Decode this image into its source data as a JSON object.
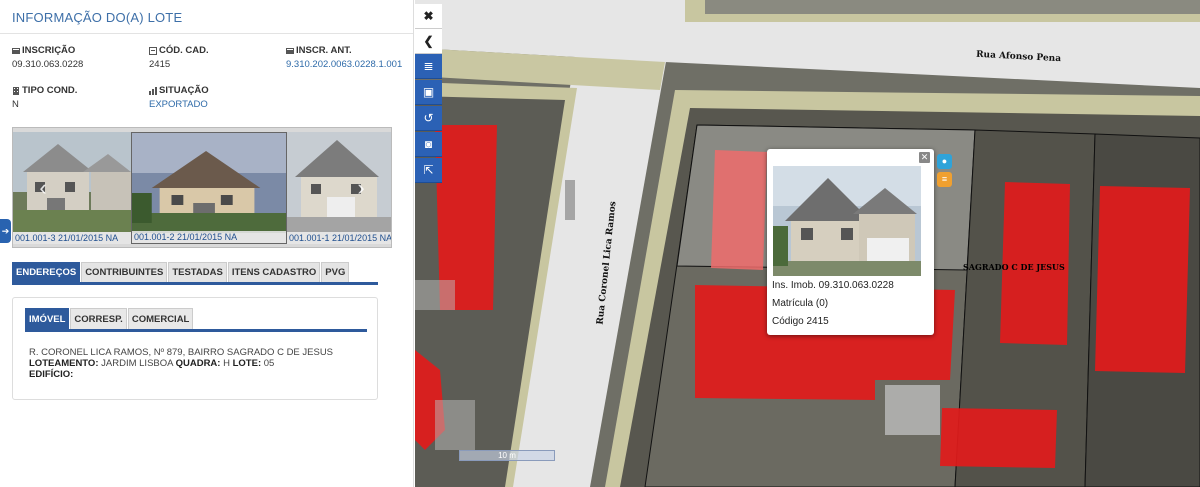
{
  "panel": {
    "title": "INFORMAÇÃO DO(A) LOTE",
    "fields": [
      {
        "label": "INSCRIÇÃO",
        "value": "09.310.063.0228",
        "link": false
      },
      {
        "label": "CÓD. CAD.",
        "value": "2415",
        "link": false
      },
      {
        "label": "INSCR. ANT.",
        "value": "9.310.202.0063.0228.1.001",
        "link": true
      },
      {
        "label": "TIPO COND.",
        "value": "N",
        "link": false
      },
      {
        "label": "SITUAÇÃO",
        "value": "EXPORTADO",
        "link": true
      }
    ],
    "photos": [
      {
        "caption": "001.001-3 21/01/2015 NA"
      },
      {
        "caption": "001.001-2 21/01/2015 NA"
      },
      {
        "caption": "001.001-1 21/01/2015 NA"
      }
    ],
    "tabs": [
      "ENDEREÇOS",
      "CONTRIBUINTES",
      "TESTADAS",
      "ITENS CADASTRO",
      "PVG"
    ],
    "subtabs": [
      "IMÓVEL",
      "CORRESP.",
      "COMERCIAL"
    ],
    "address": {
      "line1": "R. CORONEL LICA RAMOS, Nº 879, BAIRRO SAGRADO C DE JESUS",
      "loteamento_label": "LOTEAMENTO:",
      "loteamento_value": "JARDIM LISBOA",
      "quadra_label": "QUADRA:",
      "quadra_value": "H",
      "lote_label": "LOTE:",
      "lote_value": "05",
      "edificio_label": "EDIFÍCIO:"
    }
  },
  "map": {
    "streets": {
      "afonso_pena": "Rua Afonso Pena",
      "lica_ramos": "Rua Coronel Lica Ramos",
      "neighborhood": "SAGRADO C DE JESUS"
    },
    "scale_label": "10 m",
    "toolbar": [
      {
        "icon": "close-icon",
        "glyph": "✖"
      },
      {
        "icon": "chevron-left-icon",
        "glyph": "❮"
      },
      {
        "icon": "list-icon",
        "glyph": "≣"
      },
      {
        "icon": "window-icon",
        "glyph": "▣"
      },
      {
        "icon": "history-icon",
        "glyph": "↺"
      },
      {
        "icon": "camera-icon",
        "glyph": "◙"
      },
      {
        "icon": "export-icon",
        "glyph": "⇱"
      }
    ],
    "popup": {
      "inscricao": "Ins. Imob. 09.310.063.0228",
      "matricula": "Matrícula (0)",
      "codigo": "Código 2415"
    }
  },
  "colors": {
    "accent": "#2e5a9c",
    "parcel_red": "#e21b1b",
    "info_button": "#2fa3d9",
    "list_button": "#f0a030"
  }
}
